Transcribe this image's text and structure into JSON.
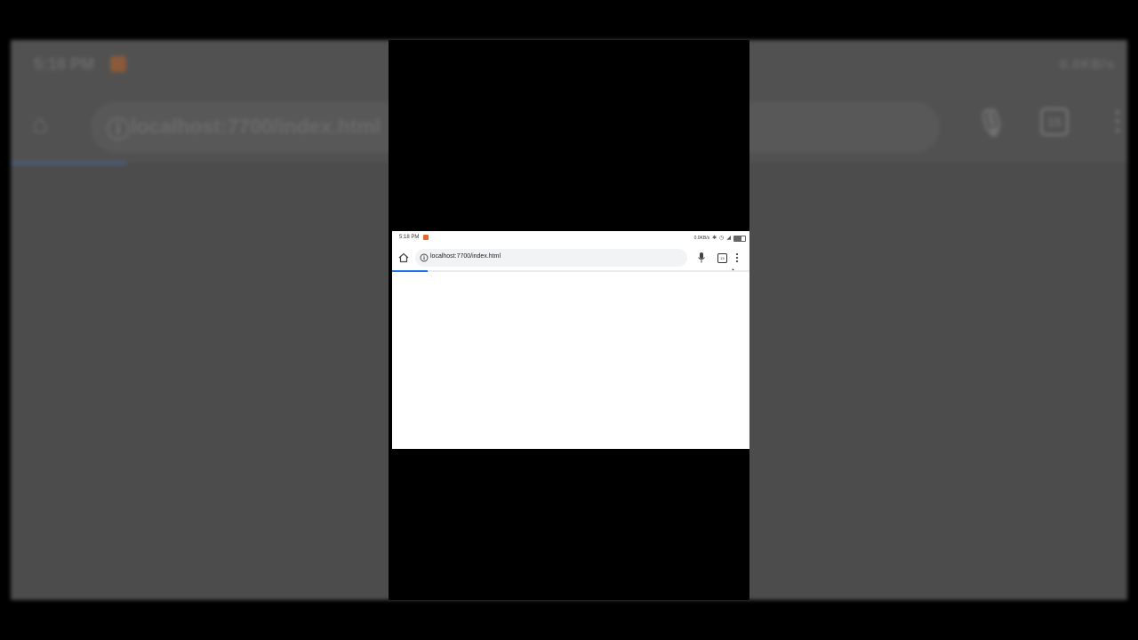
{
  "status_bar": {
    "time": "5:18 PM",
    "network_speed": "0.0KB/s",
    "battery_level": 0.7
  },
  "browser": {
    "url": "localhost:7700/index.html",
    "tab_count": "15",
    "load_progress": 0.1
  },
  "icons": {
    "home": "home-icon",
    "info": "info-icon",
    "mic": "mic-icon",
    "tabs": "tab-switcher-icon",
    "menu": "more-vert-icon",
    "cursor": "mouse-pointer-icon"
  },
  "colors": {
    "progress": "#1a73e8",
    "omnibox_bg": "#f1f3f4",
    "notification": "#e8662c"
  }
}
